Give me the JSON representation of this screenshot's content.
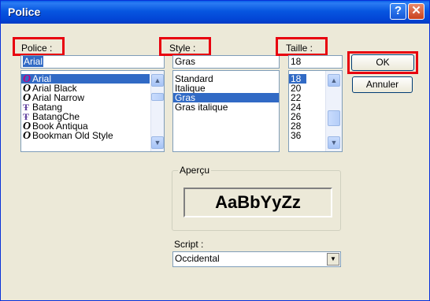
{
  "window": {
    "title": "Police",
    "help_label": "?",
    "close_label": "✕"
  },
  "font": {
    "label": "Police :",
    "value": "Arial",
    "items": [
      "Arial",
      "Arial Black",
      "Arial Narrow",
      "Batang",
      "BatangChe",
      "Book Antiqua",
      "Bookman Old Style"
    ],
    "selected_index": 0
  },
  "style": {
    "label": "Style :",
    "value": "Gras",
    "items": [
      "Standard",
      "Italique",
      "Gras",
      "Gras italique"
    ],
    "selected_index": 2
  },
  "size": {
    "label": "Taille :",
    "value": "18",
    "items": [
      "18",
      "20",
      "22",
      "24",
      "26",
      "28",
      "36"
    ],
    "selected_index": 0
  },
  "buttons": {
    "ok": "OK",
    "cancel": "Annuler"
  },
  "preview": {
    "label": "Aperçu",
    "sample": "AaBbYyZz"
  },
  "script": {
    "label": "Script :",
    "value": "Occidental"
  },
  "icons": {
    "font_type": "opentype-icon",
    "truetype": "truetype-icon"
  },
  "colors": {
    "title_bar": "#0756e0",
    "selection": "#316ac5",
    "highlight_box": "#e8000f",
    "dialog_bg": "#ece9d8"
  }
}
